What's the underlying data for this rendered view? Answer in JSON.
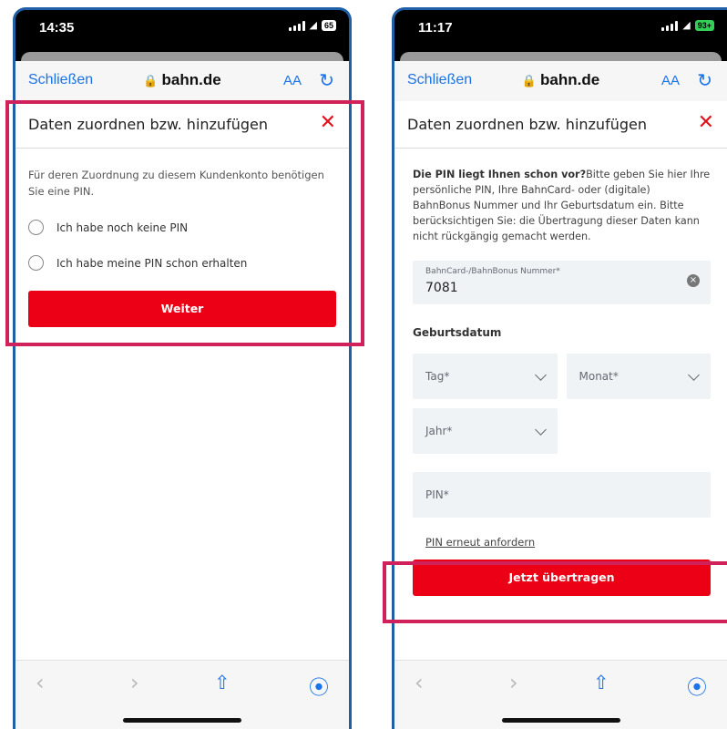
{
  "left": {
    "status": {
      "time": "14:35",
      "battery": "65"
    },
    "browser": {
      "close_label": "Schließen",
      "domain": "bahn.de",
      "text_size": "AA"
    },
    "dialog": {
      "title": "Daten zuordnen bzw. hinzufügen",
      "intro": "Für deren Zuordnung zu diesem Kundenkonto benötigen Sie eine PIN.",
      "options": [
        "Ich habe noch keine PIN",
        "Ich habe meine PIN schon erhalten"
      ],
      "button": "Weiter"
    }
  },
  "right": {
    "status": {
      "time": "11:17",
      "battery": "93+"
    },
    "browser": {
      "close_label": "Schließen",
      "domain": "bahn.de",
      "text_size": "AA"
    },
    "dialog": {
      "title": "Daten zuordnen bzw. hinzufügen",
      "intro_bold": "Die PIN liegt Ihnen schon vor?",
      "intro_text": "Bitte geben Sie hier Ihre persönliche PIN, Ihre BahnCard- oder (digitale) BahnBonus Nummer und Ihr Geburtsdatum ein. Bitte berücksichtigen Sie: die Übertragung dieser Daten kann nicht rückgängig gemacht werden.",
      "card_label": "BahnCard-/BahnBonus Nummer*",
      "card_value": "7081",
      "birth_heading": "Geburtsdatum",
      "day": "Tag*",
      "month": "Monat*",
      "year": "Jahr*",
      "pin_placeholder": "PIN*",
      "pin_link": "PIN erneut anfordern",
      "submit": "Jetzt übertragen"
    }
  },
  "colors": {
    "accent": "#ec0016",
    "highlight": "#d0215a",
    "link": "#1a73e8",
    "frame": "#1f5fa8"
  }
}
